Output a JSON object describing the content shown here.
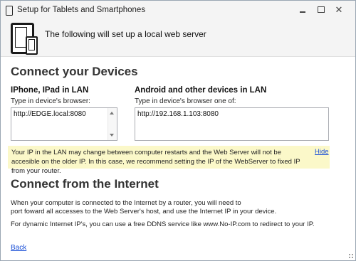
{
  "window": {
    "title": "Setup for Tablets and Smartphones"
  },
  "header": {
    "text": "The following will set up a local web server"
  },
  "devices": {
    "heading": "Connect your Devices",
    "left": {
      "title": "IPhone, IPad in LAN",
      "label": "Type in device's browser:",
      "value": "http://EDGE.local:8080"
    },
    "right": {
      "title": "Android and other devices in LAN",
      "label": "Type in device's browser one of:",
      "value": "http://192.168.1.103:8080"
    }
  },
  "notice": {
    "text": "Your IP in the LAN may change between computer restarts and the Web Server will not be accesible on the older IP. In this case, we recommend setting the IP of the WebServer to fixed IP from your router.",
    "hide_label": "Hide",
    "background": "#fbf8c9"
  },
  "internet": {
    "heading": "Connect from the Internet",
    "para1_line1": "When your computer is connected to the Internet by a router, you will need to",
    "para1_line2": "port foward all accesses to the Web Server's host, and use the Internet IP in your device.",
    "para2": "For dynamic Internet IP's, you can use a free DDNS service like www.No-IP.com to redirect to your IP."
  },
  "footer": {
    "back_label": "Back"
  },
  "colors": {
    "link": "#1a4fd6"
  }
}
